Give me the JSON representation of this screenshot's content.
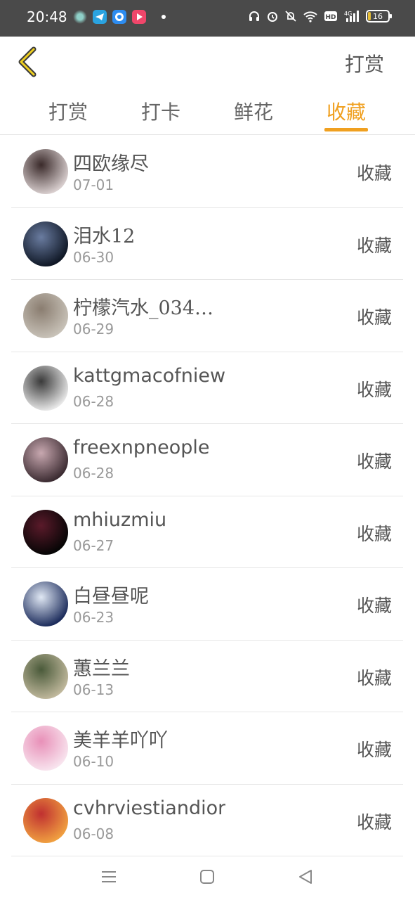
{
  "status_bar": {
    "time": "20:48",
    "battery": "16",
    "battery_fill_fraction": 0.16,
    "icons": [
      "app-icon",
      "telegram-icon",
      "browser-icon",
      "video-app-icon",
      "headphones-icon",
      "alarm-icon",
      "mute-icon",
      "wifi-icon",
      "hd-icon",
      "signal-4g-icon",
      "battery-icon"
    ]
  },
  "header": {
    "right_label": "打赏",
    "back_icon": "chevron-left-icon",
    "accent_color": "#f0a020"
  },
  "tabs": [
    {
      "label": "打赏",
      "active": false
    },
    {
      "label": "打卡",
      "active": false
    },
    {
      "label": "鲜花",
      "active": false
    },
    {
      "label": "收藏",
      "active": true
    }
  ],
  "list": [
    {
      "name": "四欧缘尽",
      "date": "07-01",
      "action": "收藏",
      "avatar_colors": [
        "#d9cfcf",
        "#3a2a2a"
      ]
    },
    {
      "name": "泪水12",
      "date": "06-30",
      "action": "收藏",
      "avatar_colors": [
        "#0e1624",
        "#6a7ca0"
      ]
    },
    {
      "name": "柠檬汽水_034…",
      "date": "06-29",
      "action": "收藏",
      "avatar_colors": [
        "#c8c2b8",
        "#8a7d70"
      ]
    },
    {
      "name": "kattgmacofniew",
      "date": "06-28",
      "action": "收藏",
      "avatar_colors": [
        "#e8e8e8",
        "#3a3a3a"
      ]
    },
    {
      "name": "freexnpneople",
      "date": "06-28",
      "action": "收藏",
      "avatar_colors": [
        "#3a2a30",
        "#c8a8b0"
      ]
    },
    {
      "name": "mhiuzmiu",
      "date": "06-27",
      "action": "收藏",
      "avatar_colors": [
        "#050505",
        "#5a1a2a"
      ]
    },
    {
      "name": "白昼昼呢",
      "date": "06-23",
      "action": "收藏",
      "avatar_colors": [
        "#1a2a5a",
        "#e0e8f4"
      ]
    },
    {
      "name": "蕙兰兰",
      "date": "06-13",
      "action": "收藏",
      "avatar_colors": [
        "#c0b89c",
        "#4a5a3a"
      ]
    },
    {
      "name": "美羊羊吖吖",
      "date": "06-10",
      "action": "收藏",
      "avatar_colors": [
        "#f8e4ee",
        "#e890b8"
      ]
    },
    {
      "name": "cvhrviestiandior",
      "date": "06-08",
      "action": "收藏",
      "avatar_colors": [
        "#f0a040",
        "#c03030"
      ]
    }
  ],
  "nav_bar": {
    "icons": [
      "menu-icon",
      "home-square-icon",
      "back-triangle-icon"
    ]
  }
}
